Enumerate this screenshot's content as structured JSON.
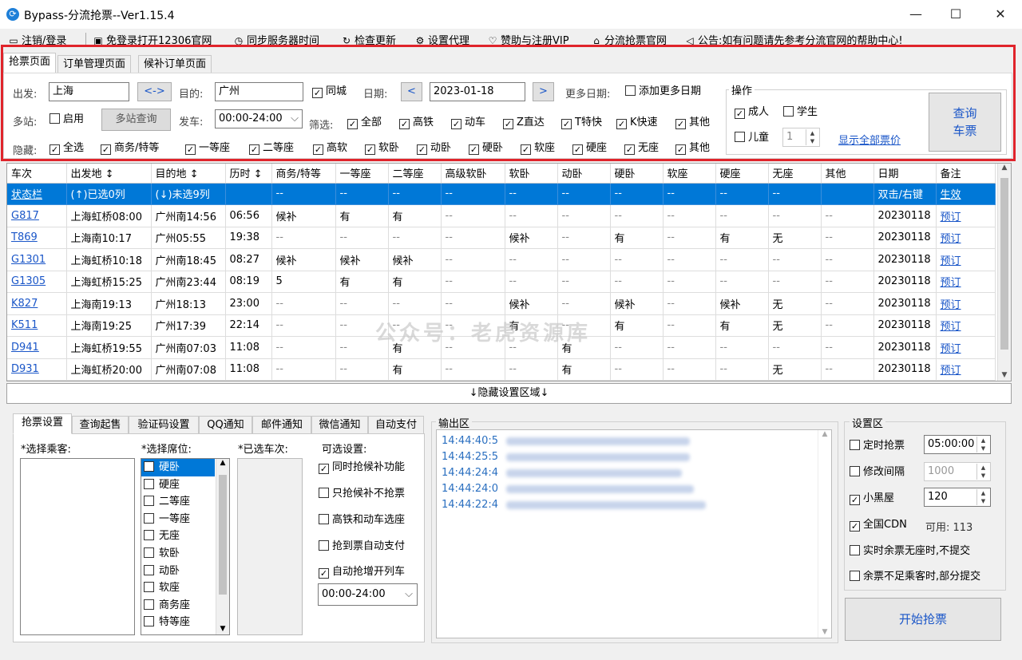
{
  "window": {
    "title": "Bypass-分流抢票--Ver1.15.4",
    "minimize": "—",
    "maximize": "☐",
    "close": "✕"
  },
  "menu": {
    "logout": "注销/登录",
    "open12306": "免登录打开12306官网",
    "sync_time": "同步服务器时间",
    "check_update": "检查更新",
    "proxy": "设置代理",
    "vip": "赞助与注册VIP",
    "site": "分流抢票官网",
    "notice": "公告:如有问题请先参考分流官网的帮助中心!"
  },
  "tabs": [
    "抢票页面",
    "订单管理页面",
    "候补订单页面"
  ],
  "query": {
    "from_label": "出发:",
    "from_value": "上海",
    "swap": "<->",
    "to_label": "目的:",
    "to_value": "广州",
    "same_city": "同城",
    "date_label": "日期:",
    "prev": "<",
    "date_value": "2023-01-18",
    "next": ">",
    "more_dates_label": "更多日期:",
    "add_more_dates": "添加更多日期",
    "multi_label": "多站:",
    "enable": "启用",
    "multi_query": "多站查询",
    "depart_label": "发车:",
    "time_range": "00:00-24:00",
    "filter_label": "筛选:",
    "filters": [
      "全部",
      "高铁",
      "动车",
      "Z直达",
      "T特快",
      "K快速",
      "其他"
    ],
    "hide_label": "隐藏:",
    "hides": [
      "全选",
      "商务/特等",
      "一等座",
      "二等座",
      "高软",
      "软卧",
      "动卧",
      "硬卧",
      "软座",
      "硬座",
      "无座",
      "其他"
    ]
  },
  "ops": {
    "title": "操作",
    "adult": "成人",
    "student": "学生",
    "child": "儿童",
    "child_count": "1",
    "show_prices": "显示全部票价",
    "query_line1": "查询",
    "query_line2": "车票"
  },
  "table": {
    "headers": [
      "车次",
      "出发地 ↕",
      "目的地 ↕",
      "历时 ↕",
      "商务/特等",
      "一等座",
      "二等座",
      "高级软卧",
      "软卧",
      "动卧",
      "硬卧",
      "软座",
      "硬座",
      "无座",
      "其他",
      "日期",
      "备注"
    ],
    "rows": [
      [
        "状态栏",
        "(↑)已选0列",
        "(↓)未选9列",
        "",
        "--",
        "--",
        "--",
        "--",
        "--",
        "--",
        "--",
        "--",
        "--",
        "--",
        "",
        "双击/右键",
        "生效"
      ],
      [
        "G817",
        "上海虹桥08:00",
        "广州南14:56",
        "06:56",
        "候补",
        "有",
        "有",
        "--",
        "--",
        "--",
        "--",
        "--",
        "--",
        "--",
        "--",
        "20230118",
        "预订"
      ],
      [
        "T869",
        "上海南10:17",
        "广州05:55",
        "19:38",
        "--",
        "--",
        "--",
        "--",
        "候补",
        "--",
        "有",
        "--",
        "有",
        "无",
        "--",
        "20230118",
        "预订"
      ],
      [
        "G1301",
        "上海虹桥10:18",
        "广州南18:45",
        "08:27",
        "候补",
        "候补",
        "候补",
        "--",
        "--",
        "--",
        "--",
        "--",
        "--",
        "--",
        "--",
        "20230118",
        "预订"
      ],
      [
        "G1305",
        "上海虹桥15:25",
        "广州南23:44",
        "08:19",
        "5",
        "有",
        "有",
        "--",
        "--",
        "--",
        "--",
        "--",
        "--",
        "--",
        "--",
        "20230118",
        "预订"
      ],
      [
        "K827",
        "上海南19:13",
        "广州18:13",
        "23:00",
        "--",
        "--",
        "--",
        "--",
        "候补",
        "--",
        "候补",
        "--",
        "候补",
        "无",
        "--",
        "20230118",
        "预订"
      ],
      [
        "K511",
        "上海南19:25",
        "广州17:39",
        "22:14",
        "--",
        "--",
        "--",
        "--",
        "有",
        "--",
        "有",
        "--",
        "有",
        "无",
        "--",
        "20230118",
        "预订"
      ],
      [
        "D941",
        "上海虹桥19:55",
        "广州南07:03",
        "11:08",
        "--",
        "--",
        "有",
        "--",
        "--",
        "有",
        "--",
        "--",
        "--",
        "--",
        "--",
        "20230118",
        "预订"
      ],
      [
        "D931",
        "上海虹桥20:00",
        "广州南07:08",
        "11:08",
        "--",
        "--",
        "有",
        "--",
        "--",
        "有",
        "--",
        "--",
        "--",
        "无",
        "--",
        "20230118",
        "预订"
      ]
    ]
  },
  "watermark": "公众号：老虎资源库",
  "hide_area": "↓隐藏设置区域↓",
  "bottom_tabs": [
    "抢票设置",
    "查询起售",
    "验证码设置",
    "QQ通知",
    "邮件通知",
    "微信通知",
    "自动支付"
  ],
  "settings": {
    "passenger_label": "*选择乘客:",
    "seat_label": "*选择席位:",
    "selected_trains_label": "*已选车次:",
    "optional_label": "可选设置:",
    "seats": [
      "硬卧",
      "硬座",
      "二等座",
      "一等座",
      "无座",
      "软卧",
      "动卧",
      "软座",
      "商务座",
      "特等座"
    ],
    "opts": [
      "同时抢候补功能",
      "只抢候补不抢票",
      "高铁和动车选座",
      "抢到票自动支付",
      "自动抢增开列车"
    ],
    "time_range": "00:00-24:00"
  },
  "output": {
    "title": "输出区",
    "times": [
      "14:44:40:5",
      "14:44:25:5",
      "14:44:24:4",
      "14:44:24:0",
      "14:44:22:4"
    ]
  },
  "config": {
    "title": "设置区",
    "timed_label": "定时抢票",
    "timed_value": "05:00:00",
    "interval_label": "修改间隔",
    "interval_value": "1000",
    "blackroom_label": "小黑屋",
    "blackroom_value": "120",
    "cdn_label": "全国CDN",
    "cdn_avail": "可用: 113",
    "realtime_label": "实时余票无座时,不提交",
    "partial_label": "余票不足乘客时,部分提交",
    "start": "开始抢票"
  }
}
